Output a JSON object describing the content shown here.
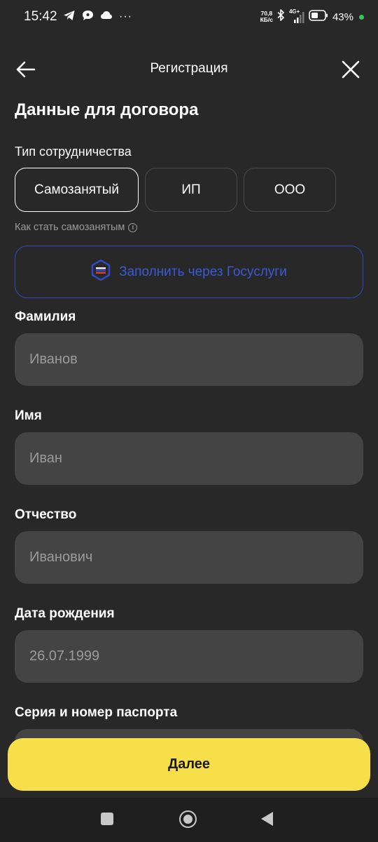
{
  "status_bar": {
    "time": "15:42",
    "speed_value": "70,8",
    "speed_unit": "КБ/с",
    "network": "4G+",
    "battery": "43%"
  },
  "header": {
    "title": "Регистрация"
  },
  "page": {
    "title": "Данные для договора",
    "cooperation_label": "Тип сотрудничества",
    "cooperation_options": [
      "Самозанятый",
      "ИП",
      "ООО"
    ],
    "selected_option": "Самозанятый",
    "how_to_link": "Как стать самозанятым",
    "gosuslugi_button": "Заполнить через Госуслуги"
  },
  "fields": [
    {
      "label": "Фамилия",
      "placeholder": "Иванов"
    },
    {
      "label": "Имя",
      "placeholder": "Иван"
    },
    {
      "label": "Отчество",
      "placeholder": "Иванович"
    },
    {
      "label": "Дата рождения",
      "placeholder": "26.07.1999"
    },
    {
      "label": "Серия и номер паспорта",
      "placeholder": ""
    }
  ],
  "footer": {
    "next_button": "Далее"
  },
  "colors": {
    "background": "#282828",
    "input_bg": "#444444",
    "accent_yellow": "#f7df4a",
    "gosuslugi_blue": "#2e4bbf"
  }
}
